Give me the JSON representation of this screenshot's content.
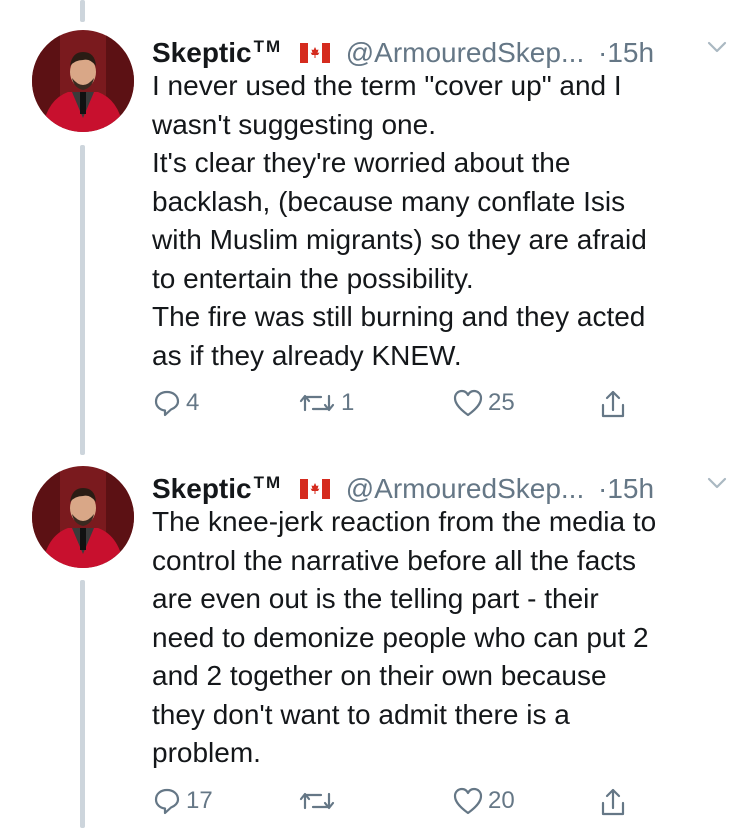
{
  "tweets": [
    {
      "author_name": "Skeptic",
      "author_mark": "TM",
      "handle": "@ArmouredSkep...",
      "separator": "·",
      "time": "15h",
      "lines": [
        "I never used the term \"cover up\" and I",
        "wasn't suggesting one.",
        "It's clear they're worried about the",
        "backlash, (because many conflate Isis",
        "with Muslim migrants) so they are afraid",
        "to entertain the possibility.",
        "The fire was still burning and they acted",
        "as if they already KNEW."
      ],
      "reply_count": "4",
      "retweet_count": "1",
      "like_count": "25"
    },
    {
      "author_name": "Skeptic",
      "author_mark": "TM",
      "handle": "@ArmouredSkep...",
      "separator": "·",
      "time": "15h",
      "lines": [
        "The knee-jerk reaction from the media to",
        "control the narrative before all the facts",
        "are even out is the telling part - their",
        "need to demonize people who can put 2",
        "and 2 together on their own because",
        "they don't want to admit there is a",
        "problem."
      ],
      "reply_count": "17",
      "retweet_count": "",
      "like_count": "20"
    }
  ],
  "icons": {
    "reply": "reply-icon",
    "retweet": "retweet-icon",
    "like": "heart-icon",
    "share": "share-icon",
    "caret": "chevron-down-icon",
    "flag": "canada-flag-icon"
  },
  "colors": {
    "text": "#14171a",
    "secondary": "#657786",
    "thread_line": "#cdd5dc",
    "avatar_jacket": "#c8102e"
  }
}
